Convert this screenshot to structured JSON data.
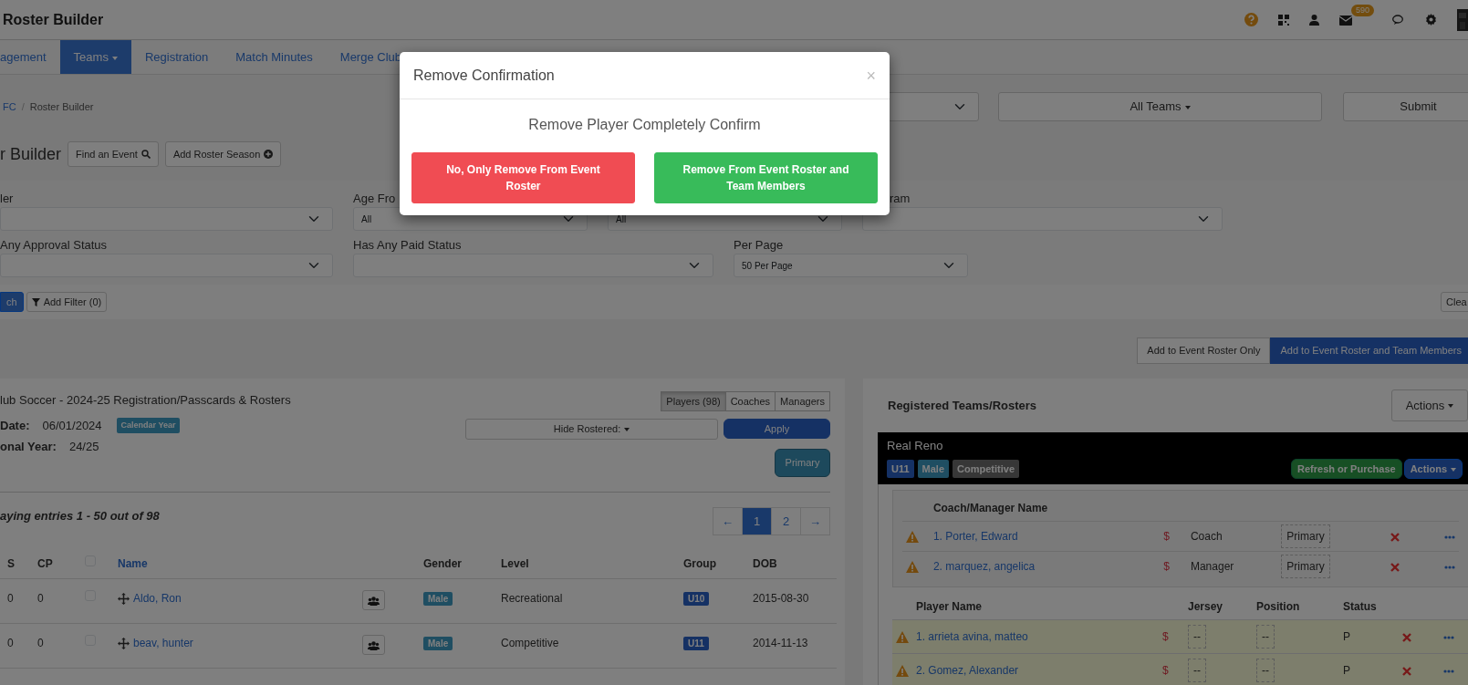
{
  "header": {
    "title": "Roster Builder",
    "mail_count": "590"
  },
  "nav": [
    {
      "label": "agement",
      "selected": false,
      "dropdown": false
    },
    {
      "label": "Teams",
      "selected": true,
      "dropdown": true
    },
    {
      "label": "Registration",
      "selected": false,
      "dropdown": false
    },
    {
      "label": "Match Minutes",
      "selected": false,
      "dropdown": false
    },
    {
      "label": "Merge Club",
      "selected": false,
      "dropdown": false
    }
  ],
  "breadcrumb": [
    "FC",
    "Roster Builder"
  ],
  "breadcrumb_separator": "/",
  "team_filter": "All Teams",
  "submit": "Submit",
  "page_title": "r Builder",
  "title_buttons": [
    "Find an Event",
    "Add Roster Season"
  ],
  "filters": [
    [
      {
        "label": "ler"
      },
      {
        "label": "Age Fro",
        "value": "All"
      },
      {
        "value": "All"
      },
      {
        "label": "ram"
      }
    ],
    [
      {
        "label": "Any Approval Status"
      },
      {
        "label": "Has Any Paid Status"
      },
      {
        "label": "Per Page",
        "value": "50 Per Page"
      }
    ]
  ],
  "filter_actions": {
    "search": "ch",
    "add_filter": "Add Filter (0)",
    "clear": "Clea"
  },
  "add_buttons": [
    {
      "label": "Add to Event Roster Only",
      "kind": "default"
    },
    {
      "label": "Add to Event Roster and Team Members",
      "kind": "primary"
    }
  ],
  "event": {
    "title": "lub Soccer - 2024-25 Registration/Passcards & Rosters",
    "date_label": "Date:",
    "date": "06/01/2024",
    "date_badge": "Calendar Year",
    "year_label": "onal Year:",
    "year": "24/25",
    "member_tabs": [
      {
        "label": "Players (98)",
        "selected": true
      },
      {
        "label": "Coaches",
        "selected": false
      },
      {
        "label": "Managers",
        "selected": false
      }
    ],
    "hide_rostered": "Hide Rostered:",
    "apply": "Apply",
    "primary": "Primary",
    "entries": "aying entries 1 - 50 out of 98",
    "pages": [
      {
        "label": "←",
        "selected": false
      },
      {
        "label": "1",
        "selected": true
      },
      {
        "label": "2",
        "selected": false
      },
      {
        "label": "→",
        "selected": false
      }
    ],
    "columns": [
      "S",
      "CP",
      "Name",
      "Gender",
      "Level",
      "Group",
      "DOB"
    ],
    "select_all_checked": false,
    "players": [
      {
        "s": "0",
        "cp": "0",
        "checked": false,
        "name": "Aldo, Ron",
        "gender": "Male",
        "level": "Recreational",
        "group": "U10",
        "dob": "2015-08-30"
      },
      {
        "s": "0",
        "cp": "0",
        "checked": false,
        "name": "beav, hunter",
        "gender": "Male",
        "level": "Competitive",
        "group": "U11",
        "dob": "2014-11-13"
      }
    ]
  },
  "roster": {
    "title": "Registered Teams/Rosters",
    "actions": "Actions",
    "team": {
      "name": "Real Reno",
      "badges": [
        {
          "label": "U11",
          "kind": "group"
        },
        {
          "label": "Male",
          "kind": "gender"
        },
        {
          "label": "Competitive",
          "kind": "level"
        }
      ],
      "refresh": "Refresh or Purchase",
      "actions": "Actions"
    },
    "staff_header": "Coach/Manager Name",
    "staff": [
      {
        "name": "1. Porter, Edward",
        "fee": "$",
        "role": "Coach",
        "type": "Primary"
      },
      {
        "name": "2. marquez, angelica",
        "fee": "$",
        "role": "Manager",
        "type": "Primary"
      }
    ],
    "player_columns": [
      "Player Name",
      "Jersey",
      "Position",
      "Status"
    ],
    "players": [
      {
        "name": "1. arrieta avina, matteo",
        "fee": "$",
        "jersey": "--",
        "position": "--",
        "status": "P"
      },
      {
        "name": "2. Gomez, Alexander",
        "fee": "$",
        "jersey": "--",
        "position": "--",
        "status": "P"
      }
    ]
  },
  "modal": {
    "title": "Remove Confirmation",
    "close": "×",
    "message": "Remove Player Completely Confirm",
    "buttons": [
      {
        "label": "No, Only Remove From Event Roster",
        "kind": "danger"
      },
      {
        "label": "Remove From Event Roster and Team Members",
        "kind": "success"
      }
    ]
  }
}
